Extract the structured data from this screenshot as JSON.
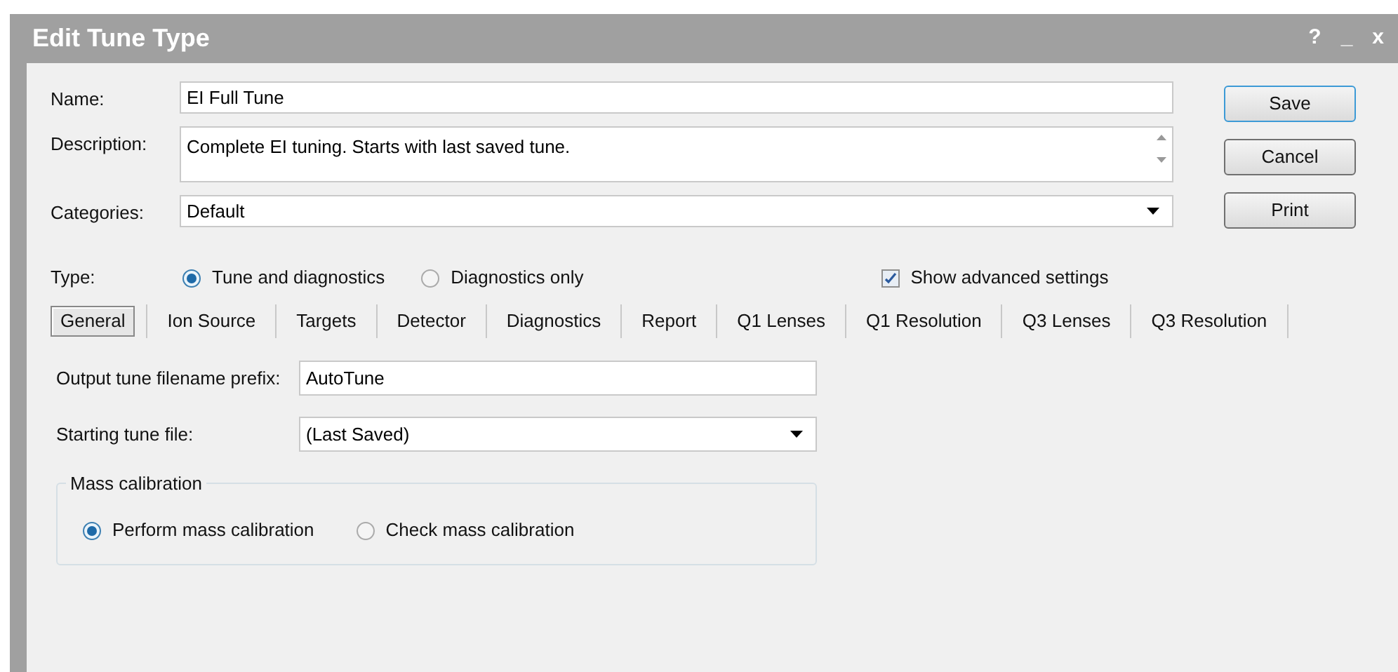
{
  "window": {
    "title": "Edit Tune Type",
    "controls": [
      "?",
      "_",
      "x"
    ]
  },
  "fields": [
    {
      "kind": "text",
      "label": "Name:",
      "value": "EI Full Tune"
    },
    {
      "kind": "textarea",
      "label": "Description:",
      "value": "Complete EI tuning. Starts with last saved tune."
    },
    {
      "kind": "dropdown",
      "label": "Categories:",
      "value": "Default"
    }
  ],
  "buttons": [
    {
      "label": "Save",
      "default": true
    },
    {
      "label": "Cancel",
      "default": false
    },
    {
      "label": "Print",
      "default": false
    }
  ],
  "type": {
    "label": "Type:",
    "options": [
      {
        "label": "Tune and diagnostics",
        "selected": true
      },
      {
        "label": "Diagnostics only",
        "selected": false
      }
    ]
  },
  "show_advanced": {
    "label": "Show advanced settings",
    "checked": true
  },
  "tabs": [
    {
      "label": "General",
      "selected": true
    },
    {
      "label": "Ion Source",
      "selected": false
    },
    {
      "label": "Targets",
      "selected": false
    },
    {
      "label": "Detector",
      "selected": false
    },
    {
      "label": "Diagnostics",
      "selected": false
    },
    {
      "label": "Report",
      "selected": false
    },
    {
      "label": "Q1 Lenses",
      "selected": false
    },
    {
      "label": "Q1 Resolution",
      "selected": false
    },
    {
      "label": "Q3 Lenses",
      "selected": false
    },
    {
      "label": "Q3 Resolution",
      "selected": false
    }
  ],
  "general": {
    "fields": [
      {
        "kind": "text",
        "label": "Output tune filename prefix:",
        "value": "AutoTune"
      },
      {
        "kind": "dropdown",
        "label": "Starting tune file:",
        "value": "(Last Saved)"
      }
    ],
    "mass_calibration": {
      "title": "Mass calibration",
      "options": [
        {
          "label": "Perform mass calibration",
          "selected": true
        },
        {
          "label": "Check mass calibration",
          "selected": false
        }
      ]
    }
  }
}
